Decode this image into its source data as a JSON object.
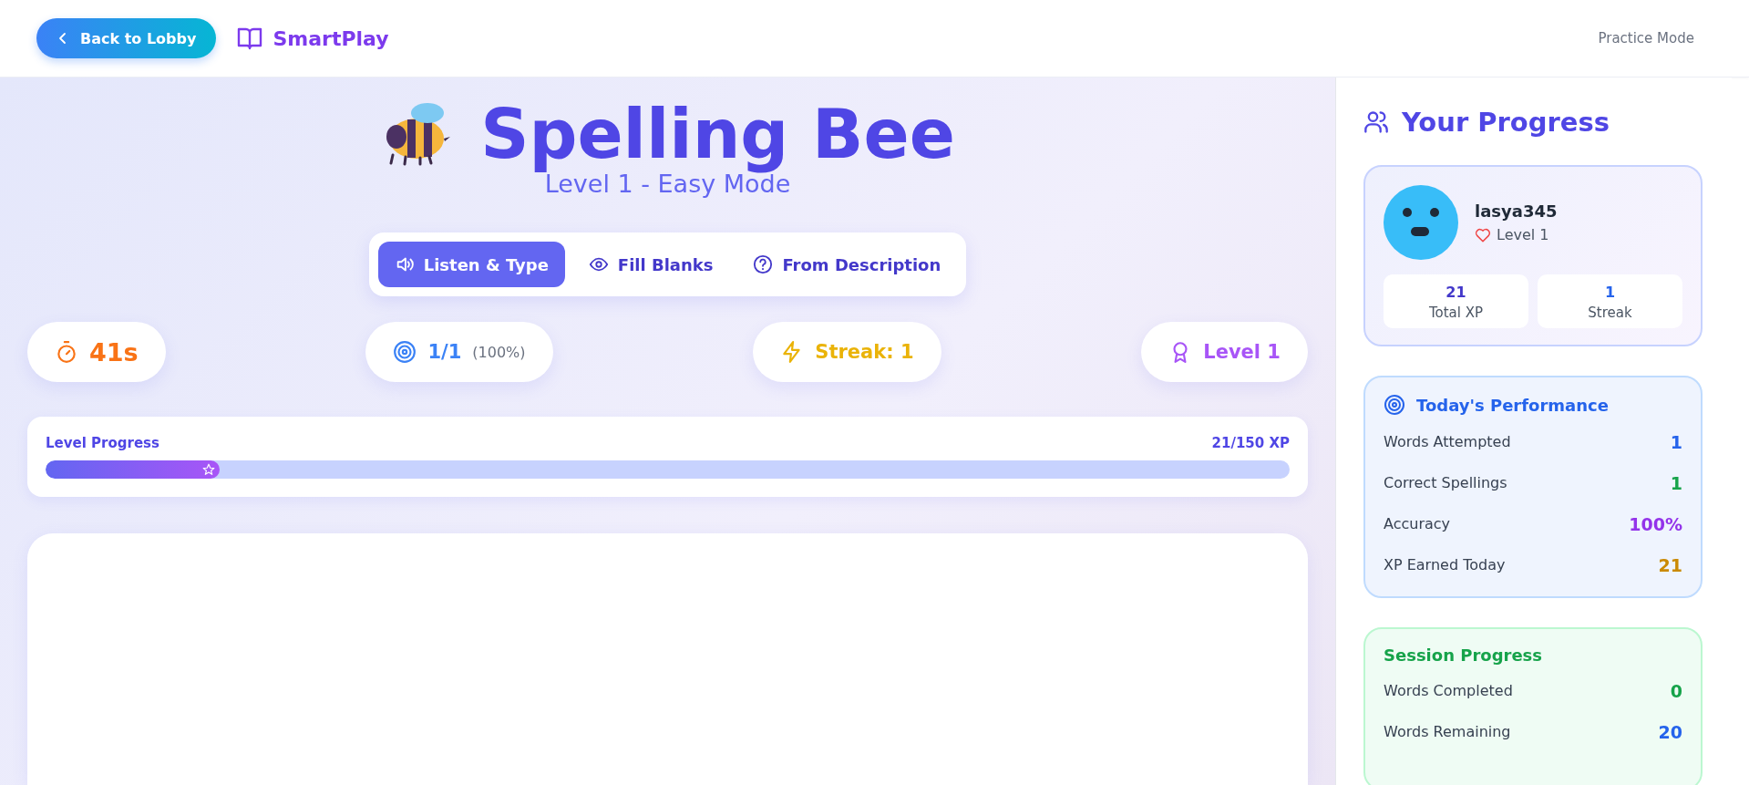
{
  "header": {
    "back_button": "Back to Lobby",
    "brand": "SmartPlay",
    "mode": "Practice Mode"
  },
  "game": {
    "title": "Spelling Bee",
    "subtitle": "Level 1 - Easy Mode",
    "modes": [
      {
        "label": "Listen & Type",
        "kind": "listen",
        "selected": true
      },
      {
        "label": "Fill Blanks",
        "kind": "fill",
        "selected": false
      },
      {
        "label": "From Description",
        "kind": "describe",
        "selected": false
      }
    ],
    "stats": [
      {
        "kind": "timer",
        "value": "41s",
        "color": "#f97316"
      },
      {
        "kind": "score",
        "value": "1/1",
        "note": "(100%)",
        "color": "#3b82f6"
      },
      {
        "kind": "streak",
        "value": "Streak: 1",
        "color": "#eab308"
      },
      {
        "kind": "level",
        "value": "Level 1",
        "color": "#a855f7"
      }
    ],
    "level_progress": {
      "label": "Level Progress",
      "reading": "21/150 XP",
      "level": 0.14
    }
  },
  "sidebar": {
    "title": "Your Progress",
    "profile": {
      "username": "lasya345",
      "level": "Level 1",
      "stats": [
        {
          "value": "21",
          "label": "Total XP"
        },
        {
          "value": "1",
          "label": "Streak"
        }
      ]
    },
    "performance": {
      "title": "Today's Performance",
      "rows": [
        {
          "label": "Words Attempted",
          "value": "1",
          "color": "#2563eb"
        },
        {
          "label": "Correct Spellings",
          "value": "1",
          "color": "#16a34a"
        },
        {
          "label": "Accuracy",
          "value": "100%",
          "color": "#9333ea"
        },
        {
          "label": "XP Earned Today",
          "value": "21",
          "color": "#ca8a04"
        }
      ]
    },
    "session": {
      "title": "Session Progress",
      "rows": [
        {
          "label": "Words Completed",
          "value": "0",
          "color": "#16a34a"
        },
        {
          "label": "Words Remaining",
          "value": "20",
          "color": "#2563eb"
        }
      ]
    }
  }
}
